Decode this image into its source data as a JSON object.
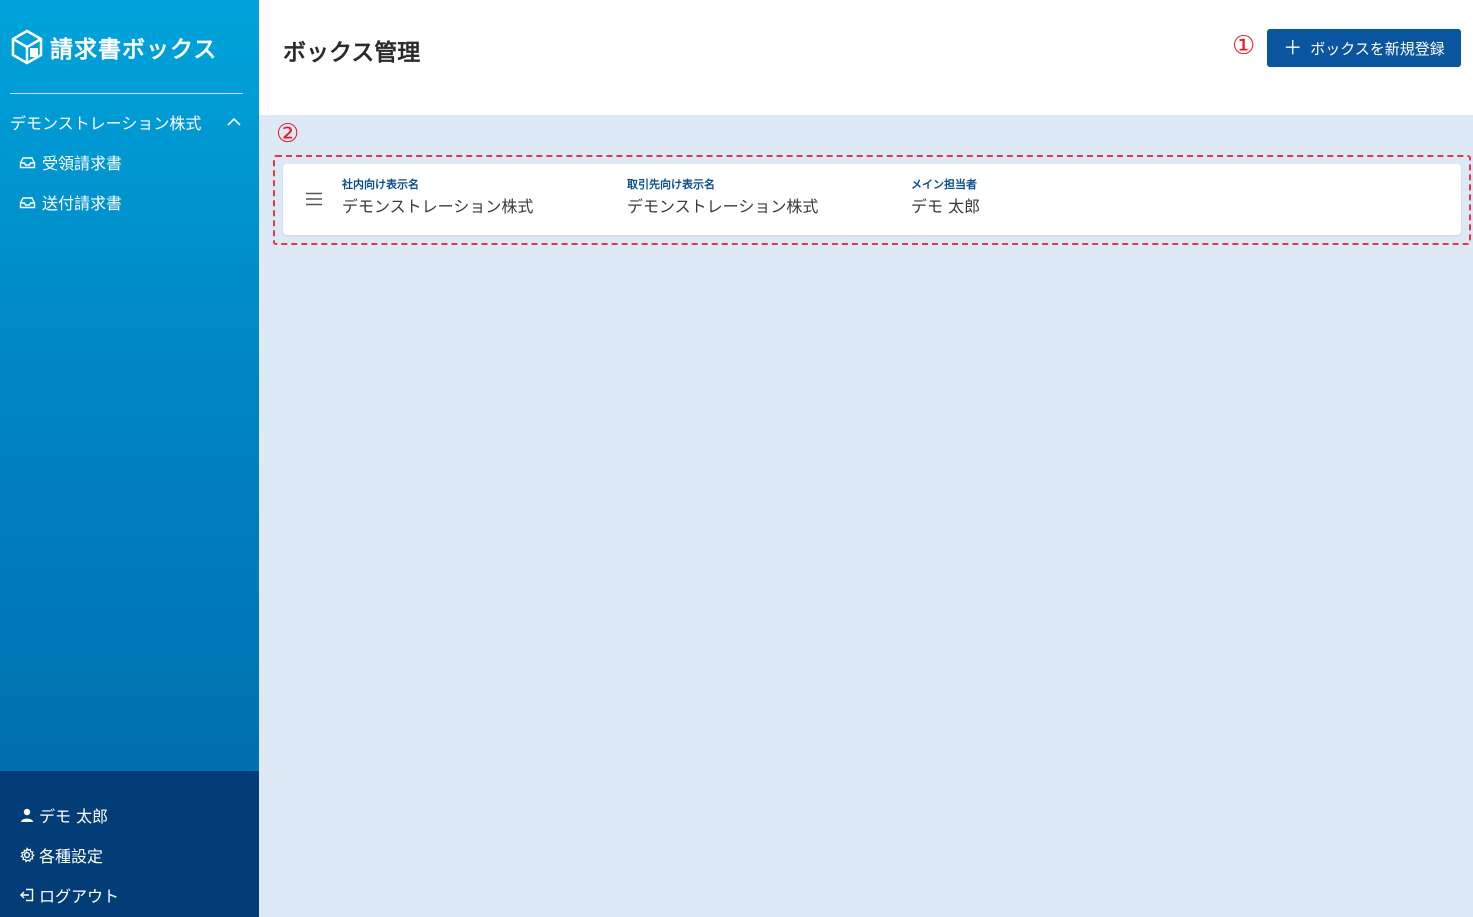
{
  "app": {
    "logo_text": "請求書ボックス"
  },
  "sidebar": {
    "company": "デモンストレーション株式",
    "items": [
      {
        "label": "受領請求書",
        "icon": "inbox-icon"
      },
      {
        "label": "送付請求書",
        "icon": "inbox-icon"
      }
    ],
    "bottom": [
      {
        "label": "デモ 太郎",
        "icon": "user-icon"
      },
      {
        "label": "各種設定",
        "icon": "gear-icon"
      },
      {
        "label": "ログアウト",
        "icon": "logout-icon"
      }
    ]
  },
  "header": {
    "title": "ボックス管理",
    "marker1": "①",
    "add_button": {
      "icon": "＋",
      "label": "ボックスを新規登録"
    }
  },
  "content": {
    "marker2": "②",
    "boxes": [
      {
        "columns": [
          {
            "label": "社内向け表示名",
            "value": "デモンストレーション株式"
          },
          {
            "label": "取引先向け表示名",
            "value": "デモンストレーション株式"
          },
          {
            "label": "メイン担当者",
            "value": "デモ 太郎"
          }
        ]
      }
    ]
  },
  "colors": {
    "primary": "#0a55a0",
    "sidebar_bottom": "#033d78",
    "background": "#dde9f5",
    "annotation": "#e0202a"
  }
}
